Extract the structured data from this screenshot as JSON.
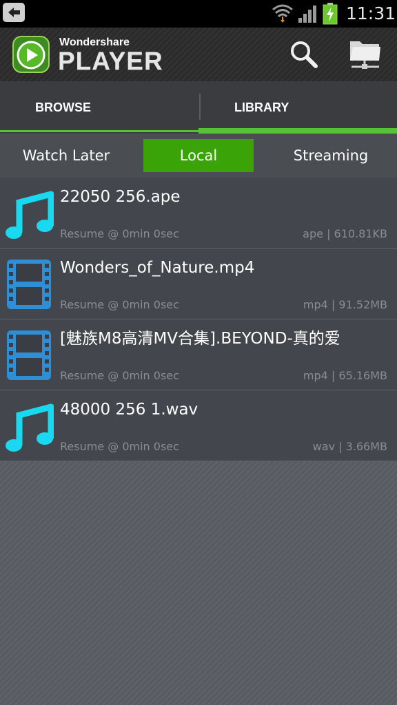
{
  "status_bar": {
    "time": "11:31",
    "icons": [
      "back-icon",
      "wifi-icon",
      "signal-icon",
      "battery-charging-icon"
    ]
  },
  "header": {
    "brand_small": "Wondershare",
    "brand_big": "PLAYER",
    "icons": [
      "search-icon",
      "network-folder-icon"
    ]
  },
  "tabs": [
    {
      "label": "BROWSE",
      "selected": false
    },
    {
      "label": "LIBRARY",
      "selected": true
    }
  ],
  "subtabs": [
    {
      "label": "Watch Later",
      "selected": false
    },
    {
      "label": "Local",
      "selected": true
    },
    {
      "label": "Streaming",
      "selected": false
    }
  ],
  "colors": {
    "accent_green": "#55c332",
    "selected_subtab": "#3aa308",
    "audio_icon": "#19d9f0",
    "video_icon": "#2f8fd6"
  },
  "items": [
    {
      "title": "22050 256.ape",
      "resume": "Resume @ 0min  0sec",
      "meta": "ape | 610.81KB",
      "icon": "music-note-icon"
    },
    {
      "title": "Wonders_of_Nature.mp4",
      "resume": "Resume @ 0min  0sec",
      "meta": "mp4 | 91.52MB",
      "icon": "film-icon"
    },
    {
      "title": "[魅族M8高清MV合集].BEYOND-真的爱",
      "resume": "Resume @ 0min  0sec",
      "meta": "mp4 | 65.16MB",
      "icon": "film-icon"
    },
    {
      "title": "48000 256 1.wav",
      "resume": "Resume @ 0min  0sec",
      "meta": "wav | 3.66MB",
      "icon": "music-note-icon"
    }
  ]
}
